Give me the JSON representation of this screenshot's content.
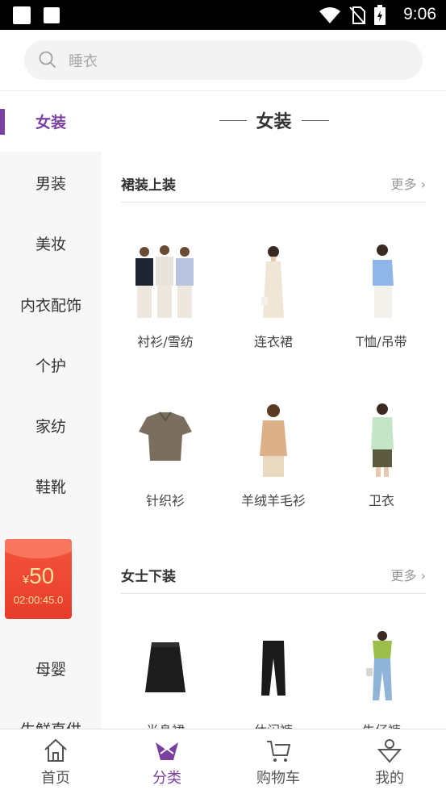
{
  "status_bar": {
    "time": "9:06"
  },
  "search": {
    "placeholder": "睡衣"
  },
  "sidebar": {
    "items": [
      {
        "label": "女装",
        "active": true
      },
      {
        "label": "男装"
      },
      {
        "label": "美妆"
      },
      {
        "label": "内衣配饰"
      },
      {
        "label": "个护"
      },
      {
        "label": "家纺"
      },
      {
        "label": "鞋靴"
      },
      {
        "label": "母婴"
      },
      {
        "label": "生鲜直供"
      }
    ],
    "red_packet": {
      "currency": "¥",
      "amount": "50",
      "countdown": "02:00:45.0"
    }
  },
  "content": {
    "title": "女装",
    "sections": [
      {
        "title": "裙装上装",
        "more": "更多",
        "products": [
          {
            "label": "衬衫/雪纺"
          },
          {
            "label": "连衣裙"
          },
          {
            "label": "T恤/吊带"
          },
          {
            "label": "针织衫"
          },
          {
            "label": "羊绒羊毛衫"
          },
          {
            "label": "卫衣"
          }
        ]
      },
      {
        "title": "女士下装",
        "more": "更多",
        "products": [
          {
            "label": "半身裙"
          },
          {
            "label": "休闲裤"
          },
          {
            "label": "牛仔裤"
          }
        ]
      }
    ]
  },
  "tabbar": {
    "tabs": [
      {
        "label": "首页"
      },
      {
        "label": "分类",
        "active": true
      },
      {
        "label": "购物车"
      },
      {
        "label": "我的"
      }
    ]
  },
  "colors": {
    "accent": "#7b3fa0",
    "red_packet": "#e83c2c",
    "sidebar_bg": "#f7f7f7"
  }
}
